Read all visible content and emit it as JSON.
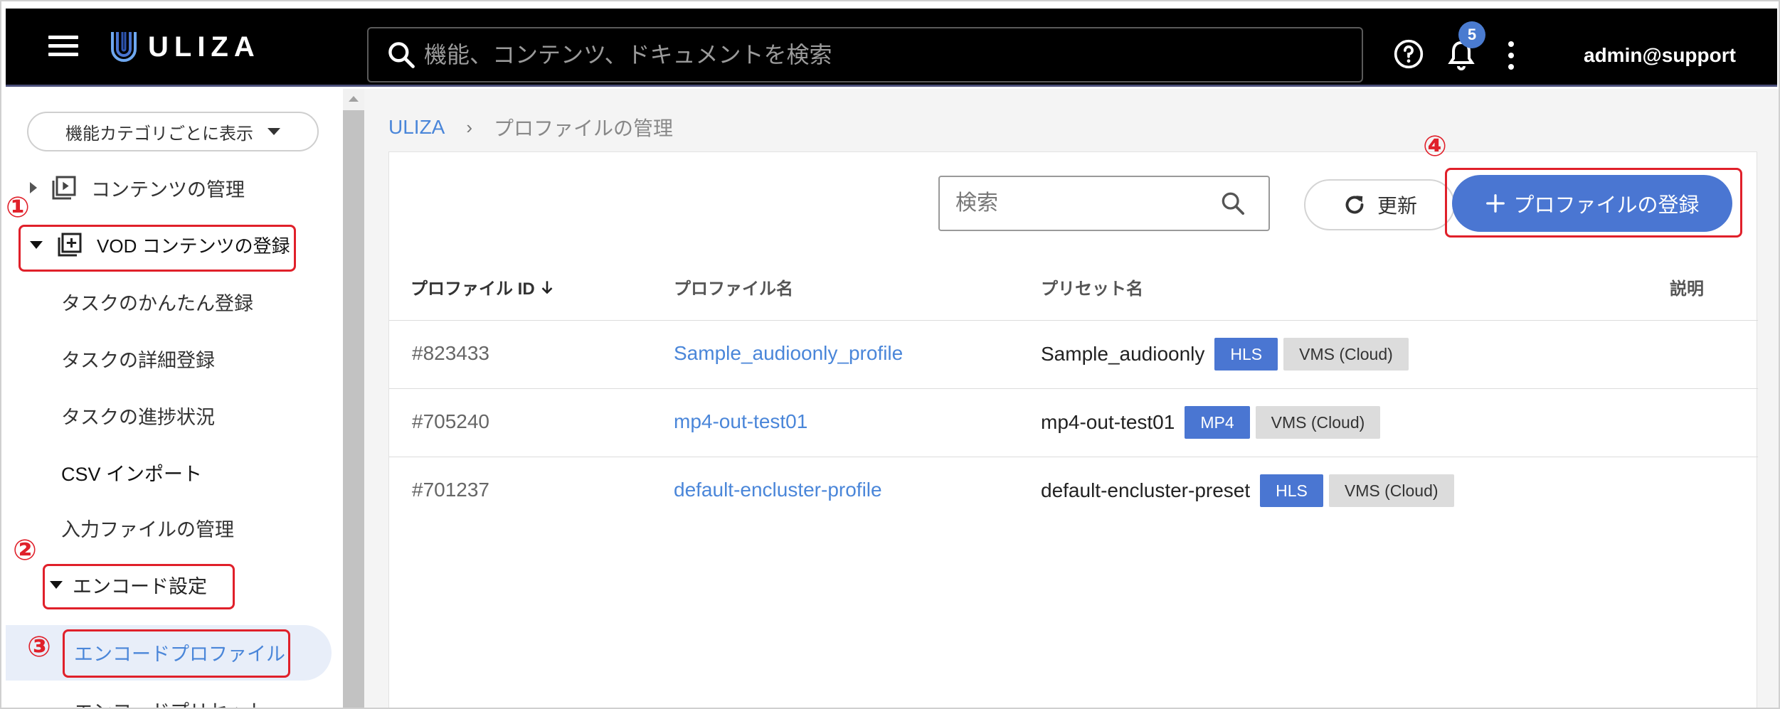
{
  "app": {
    "logo_text": "ULIZA",
    "search_placeholder": "機能、コンテンツ、ドキュメントを検索",
    "notification_count": "5",
    "user": "admin@support"
  },
  "sidebar": {
    "category_button": "機能カテゴリごとに表示",
    "items": [
      {
        "label": "コンテンツの管理"
      },
      {
        "label": "VOD コンテンツの登録"
      },
      {
        "label": "タスクのかんたん登録"
      },
      {
        "label": "タスクの詳細登録"
      },
      {
        "label": "タスクの進捗状況"
      },
      {
        "label": "CSV インポート"
      },
      {
        "label": "入力ファイルの管理"
      },
      {
        "label": "エンコード設定"
      },
      {
        "label": "エンコードプロファイル"
      },
      {
        "label": "エンコードプリセット"
      }
    ]
  },
  "callouts": [
    "①",
    "②",
    "③",
    "④"
  ],
  "breadcrumb": {
    "root": "ULIZA",
    "separator": "›",
    "current": "プロファイルの管理"
  },
  "toolbar": {
    "search_placeholder": "検索",
    "refresh_label": "更新",
    "register_label": "プロファイルの登録"
  },
  "table": {
    "columns": [
      "プロファイル ID",
      "プロファイル名",
      "プリセット名",
      "説明"
    ],
    "rows": [
      {
        "id": "#823433",
        "name": "Sample_audioonly_profile",
        "preset": "Sample_audioonly",
        "format": "HLS",
        "target": "VMS (Cloud)"
      },
      {
        "id": "#705240",
        "name": "mp4-out-test01",
        "preset": "mp4-out-test01",
        "format": "MP4",
        "target": "VMS (Cloud)"
      },
      {
        "id": "#701237",
        "name": "default-encluster-profile",
        "preset": "default-encluster-preset",
        "format": "HLS",
        "target": "VMS (Cloud)"
      }
    ]
  },
  "colors": {
    "accent": "#4a76d2",
    "link": "#4a86d9",
    "callout": "#e0202a",
    "topbar": "#000000"
  }
}
